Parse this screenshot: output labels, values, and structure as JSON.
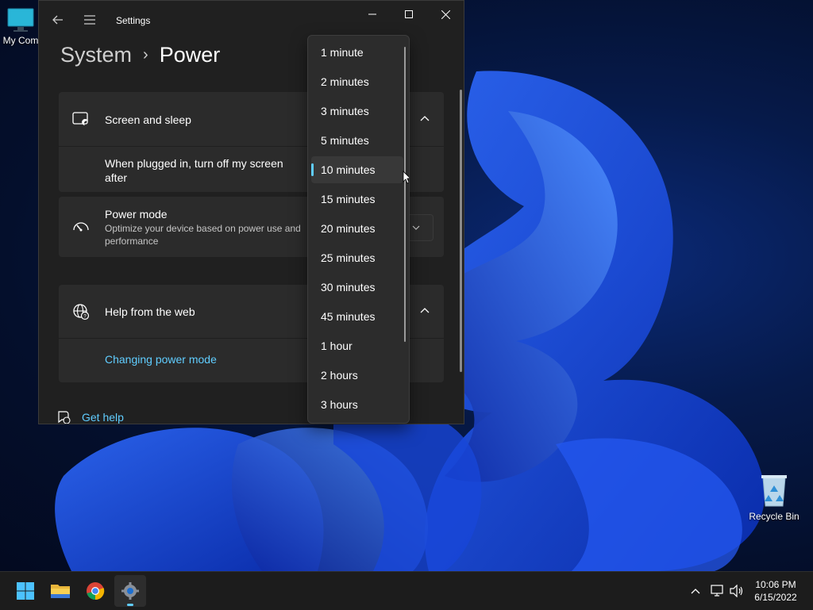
{
  "desktop": {
    "icons": {
      "my_computer": "My Com",
      "recycle_bin": "Recycle Bin"
    }
  },
  "window": {
    "title": "Settings",
    "breadcrumb": {
      "parent": "System",
      "separator": "›",
      "current": "Power"
    }
  },
  "screen_sleep": {
    "label": "Screen and sleep",
    "plugged_in_label": "When plugged in, turn off my screen after"
  },
  "power_mode": {
    "label": "Power mode",
    "description": "Optimize your device based on power use and performance"
  },
  "help": {
    "label": "Help from the web",
    "link": "Changing power mode"
  },
  "get_help": "Get help",
  "dropdown": {
    "options": [
      "1 minute",
      "2 minutes",
      "3 minutes",
      "5 minutes",
      "10 minutes",
      "15 minutes",
      "20 minutes",
      "25 minutes",
      "30 minutes",
      "45 minutes",
      "1 hour",
      "2 hours",
      "3 hours"
    ],
    "selected": "10 minutes"
  },
  "taskbar": {
    "apps": [
      "start-icon",
      "file-explorer-icon",
      "chrome-icon",
      "settings-icon"
    ],
    "clock": {
      "time": "10:06 PM",
      "date": "6/15/2022"
    }
  },
  "colors": {
    "accent": "#60cdff",
    "window_bg": "#202020",
    "card_bg": "#2b2b2b"
  }
}
